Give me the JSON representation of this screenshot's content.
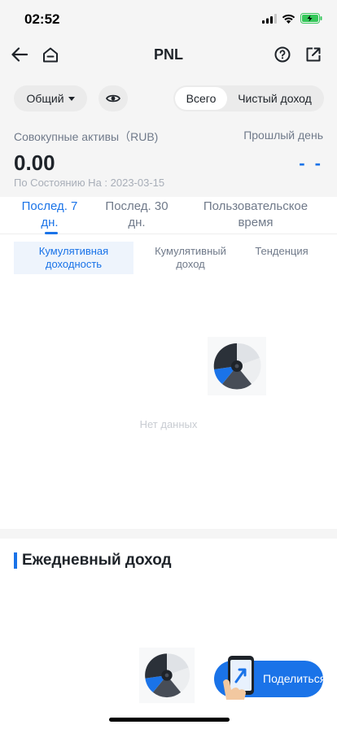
{
  "status": {
    "time": "02:52"
  },
  "nav": {
    "title": "PNL"
  },
  "summary": {
    "account_select": "Общий",
    "segment": {
      "all": "Всего",
      "net": "Чистый доход"
    },
    "assets_label": "Совокупные активы（RUB)",
    "assets_value": "0.00",
    "prev_day_label": "Прошлый день",
    "prev_day_value": "- -",
    "as_of": "По Состоянию На : 2023-03-15"
  },
  "range_tabs": [
    {
      "label_line1": "Послед. 7",
      "label_line2": "дн."
    },
    {
      "label_line1": "Послед. 30",
      "label_line2": "дн."
    },
    {
      "label_line1": "Пользовательское",
      "label_line2": "время"
    }
  ],
  "metric_tabs": [
    {
      "label_line1": "Кумулятивная",
      "label_line2": "доходность"
    },
    {
      "label_line1": "Кумулятивный",
      "label_line2": "доход"
    },
    {
      "label_line1": "Тенденция",
      "label_line2": ""
    }
  ],
  "empty": {
    "text": "Нет данных"
  },
  "daily": {
    "title": "Ежедневный доход"
  },
  "share": {
    "label": "Поделиться"
  },
  "colors": {
    "accent": "#1a73e8",
    "bg_grey": "#f5f5f5",
    "text_main": "#1e2329",
    "text_muted": "#707a8a"
  },
  "icons": [
    "back-arrow-icon",
    "home-icon",
    "help-icon",
    "share-out-icon",
    "eye-icon",
    "caret-down-icon",
    "empty-disc-icon",
    "phone-hand-icon"
  ]
}
